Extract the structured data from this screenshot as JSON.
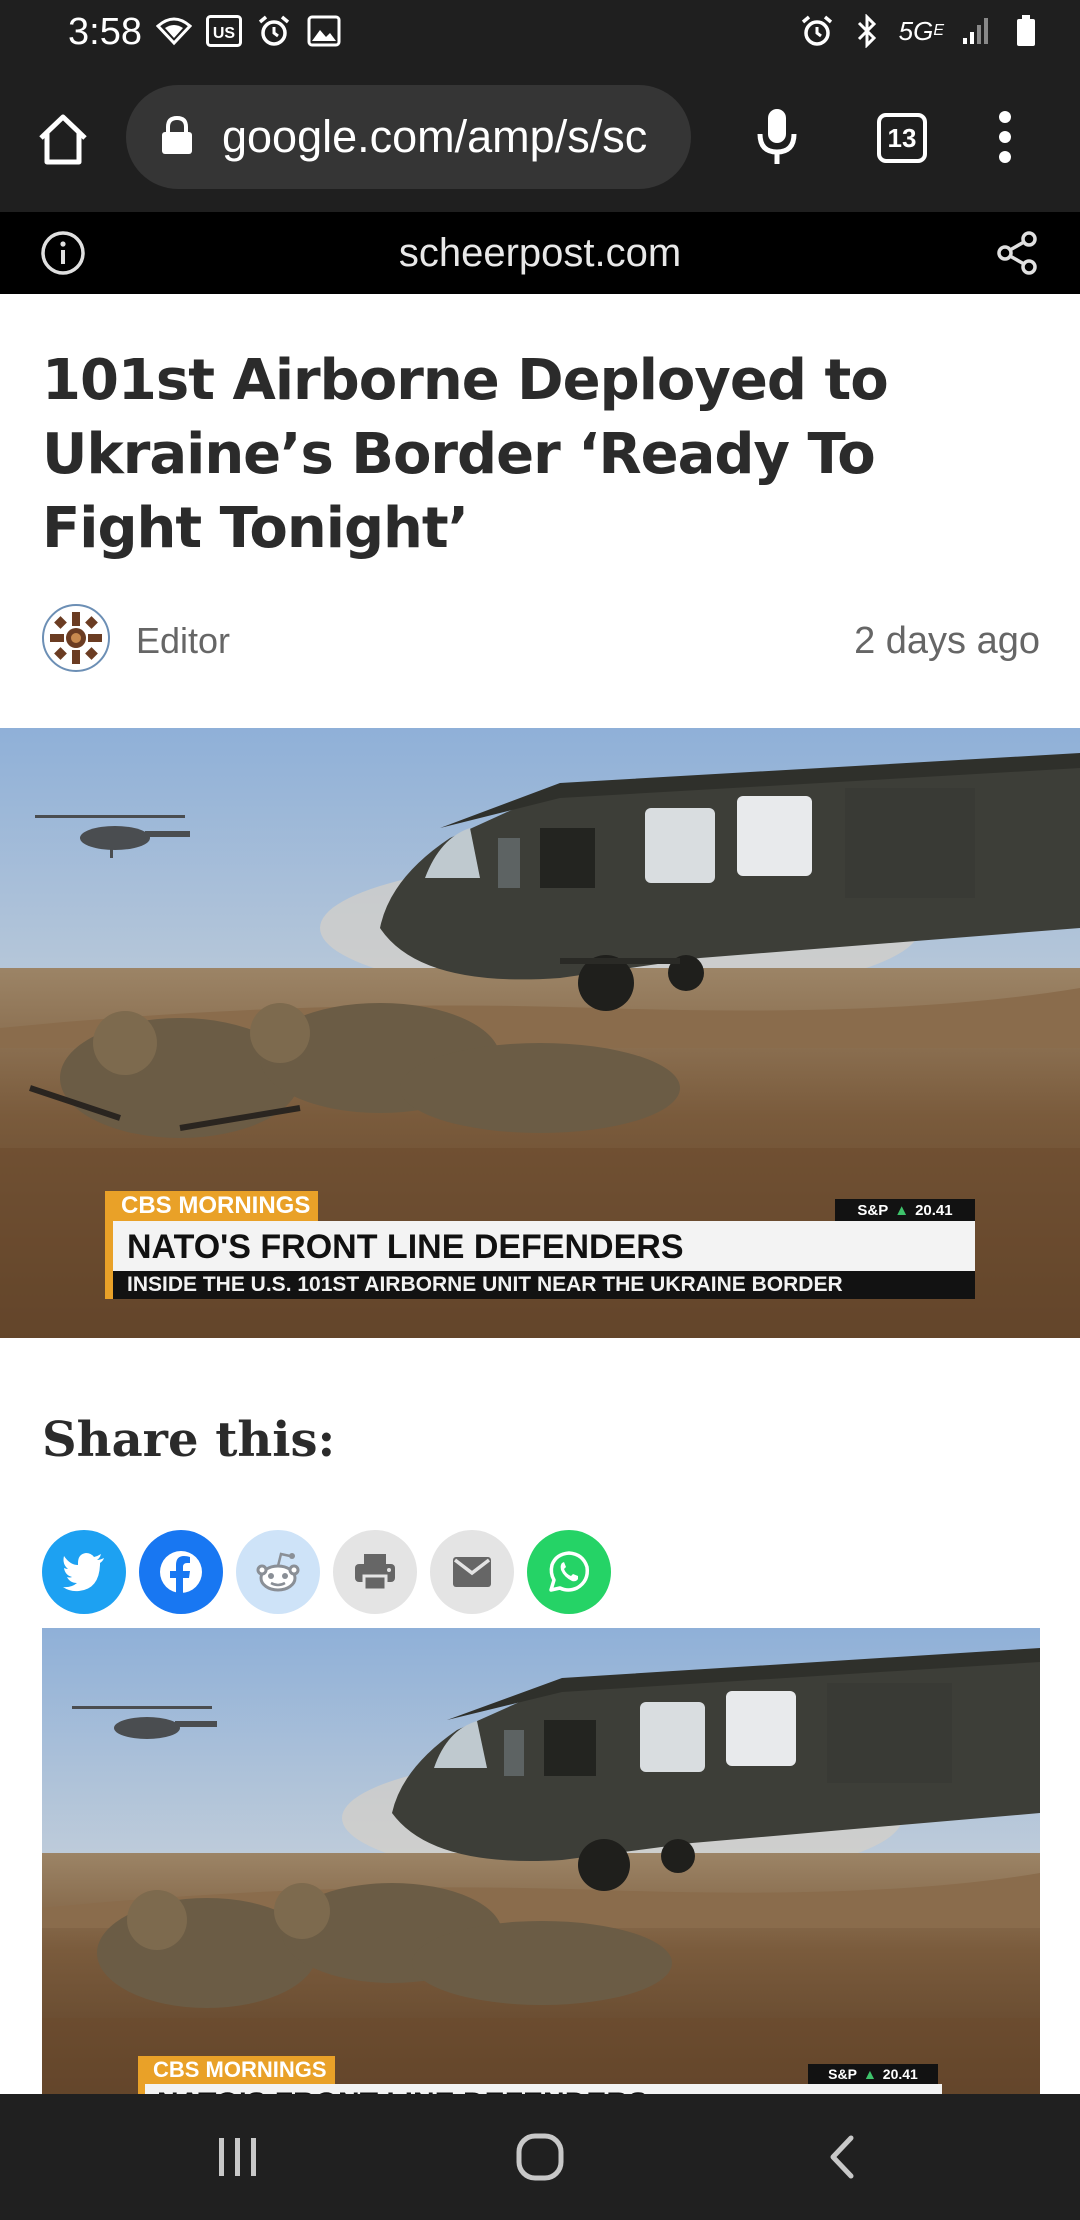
{
  "status_bar": {
    "time": "3:58",
    "network": "5G",
    "network_sub": "E",
    "left_icons": [
      "wifi-call-icon",
      "us-badge-icon",
      "alarm-icon",
      "image-icon"
    ],
    "right_icons": [
      "alarm-icon",
      "bluetooth-icon",
      "signal-icon",
      "battery-icon"
    ],
    "us_badge": "US"
  },
  "toolbar": {
    "url": "google.com/amp/s/sc",
    "tab_count": "13",
    "icons": [
      "home-icon",
      "lock-icon",
      "mic-icon",
      "tabs-icon",
      "more-vert-icon"
    ]
  },
  "amp_header": {
    "domain": "scheerpost.com",
    "icons": [
      "info-icon",
      "share-icon"
    ]
  },
  "article": {
    "headline": "101st Airborne Deployed to Ukraine’s Border ‘Ready To Fight Tonight’",
    "author": "Editor",
    "date": "2 days ago",
    "image": {
      "description_icon": "helicopter-soldiers-photo",
      "brand": "CBS MORNINGS",
      "headline": "NATO'S FRONT LINE DEFENDERS",
      "subline": "INSIDE THE U.S. 101ST AIRBORNE UNIT NEAR THE UKRAINE BORDER",
      "ticker_label": "S&P",
      "ticker_value": "20.41"
    },
    "share_title": "Share this:",
    "share_buttons": [
      {
        "name": "twitter",
        "icon": "twitter-icon",
        "color": "#1da1f2"
      },
      {
        "name": "facebook",
        "icon": "facebook-icon",
        "color": "#1877f2"
      },
      {
        "name": "reddit",
        "icon": "reddit-icon",
        "color": "#cee3f8"
      },
      {
        "name": "print",
        "icon": "print-icon",
        "color": "#e4e4e4"
      },
      {
        "name": "email",
        "icon": "email-icon",
        "color": "#e4e4e4"
      },
      {
        "name": "whatsapp",
        "icon": "whatsapp-icon",
        "color": "#25d366"
      }
    ]
  },
  "nav_bar": {
    "icons": [
      "recents-icon",
      "home-circle-icon",
      "back-icon"
    ]
  }
}
